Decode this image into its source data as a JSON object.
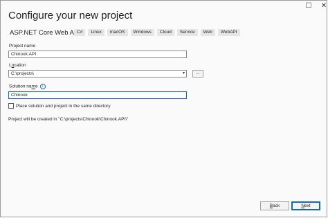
{
  "window": {
    "maximize_glyph": "☐",
    "close_glyph": "✕"
  },
  "title": "Configure your new project",
  "template": {
    "name": "ASP.NET Core Web API",
    "tags": [
      "C#",
      "Linux",
      "macOS",
      "Windows",
      "Cloud",
      "Service",
      "Web",
      "WebAPI"
    ]
  },
  "project_name": {
    "label": "Project name",
    "value": "Chinook.API"
  },
  "location": {
    "label_pre": "L",
    "label_underlined": "o",
    "label_post": "cation",
    "value": "C:\\projects\\",
    "browse_label": "..."
  },
  "solution_name": {
    "label_pre": "Solution na",
    "label_underlined": "m",
    "label_post": "e",
    "info_glyph": "i",
    "value": "Chinook"
  },
  "same_directory": {
    "label": "Place solution and project in the same directory",
    "checked": false
  },
  "created_path_text": "Project will be created in \"C:\\projects\\Chinook\\Chinook.API\\\"",
  "buttons": {
    "back_underlined": "B",
    "back_rest": "ack",
    "next_underlined": "N",
    "next_rest": "ext"
  }
}
